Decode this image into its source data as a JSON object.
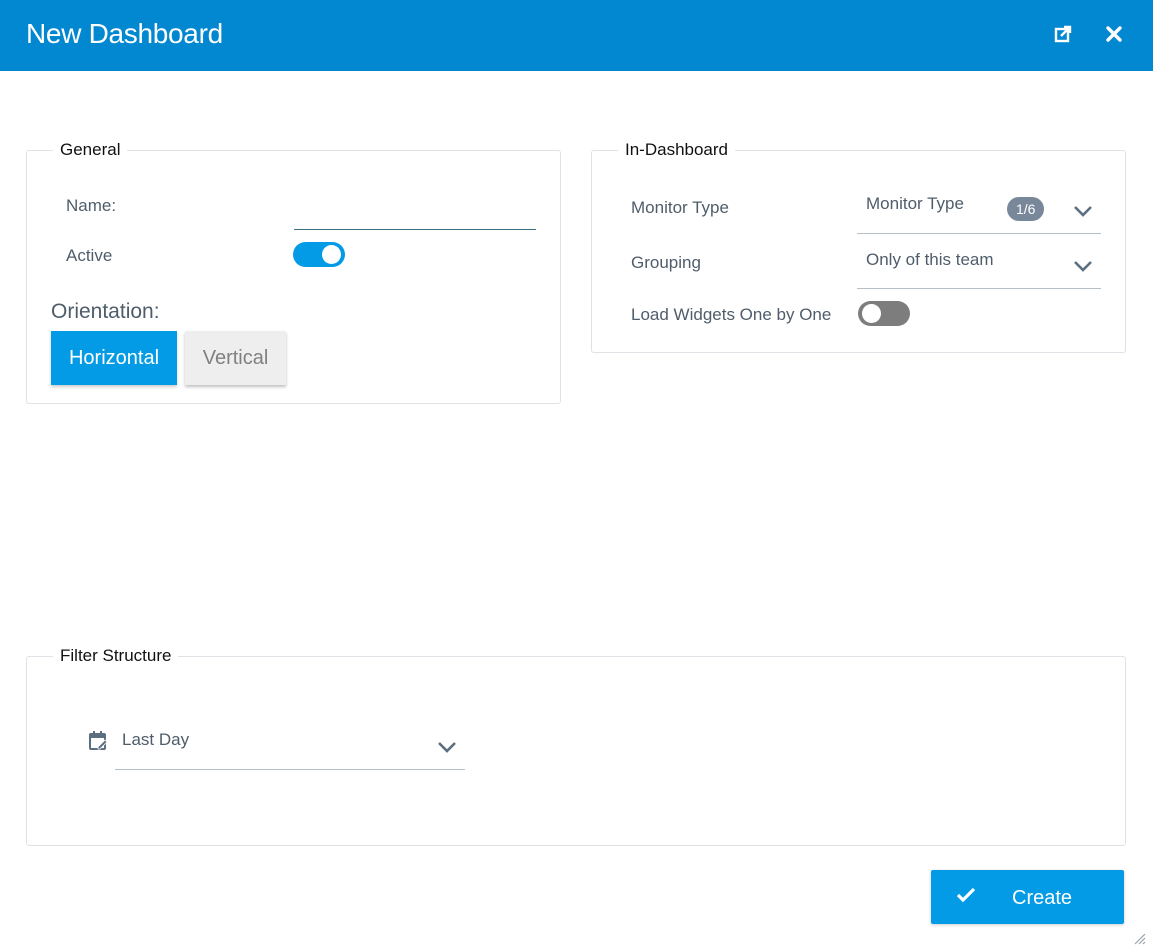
{
  "dialog": {
    "title": "New Dashboard",
    "accent_color": "#0288d1",
    "icons": {
      "popout": "external-link-icon",
      "close": "close-icon"
    }
  },
  "general": {
    "legend": "General",
    "name_label": "Name:",
    "name_value": "",
    "active_label": "Active",
    "active_on": true,
    "orientation_label": "Orientation:",
    "orientation_options": [
      "Horizontal",
      "Vertical"
    ],
    "orientation_selected": "Horizontal"
  },
  "in_dashboard": {
    "legend": "In-Dashboard",
    "monitor_type_label": "Monitor Type",
    "monitor_type_value": "Monitor Type",
    "monitor_type_badge": "1/6",
    "grouping_label": "Grouping",
    "grouping_value": "Only of this team",
    "load_widgets_label": "Load Widgets One by One",
    "load_widgets_on": false
  },
  "filter_structure": {
    "legend": "Filter Structure",
    "date_icon": "calendar-edit-icon",
    "date_range_value": "Last Day"
  },
  "footer": {
    "create_label": "Create",
    "create_icon": "check-icon"
  }
}
